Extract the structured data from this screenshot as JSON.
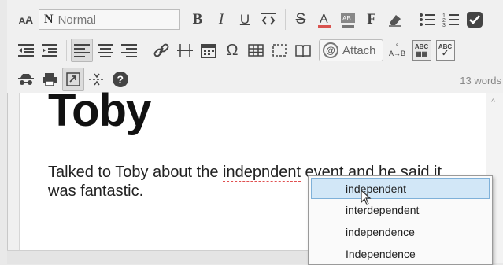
{
  "toolbar": {
    "style_select": {
      "letter": "N",
      "value": "Normal"
    },
    "attach_label": "Attach",
    "abc_labels": [
      "ABC",
      "ABC"
    ],
    "word_count": "13 words"
  },
  "document": {
    "title": "Toby",
    "paragraph": {
      "before": "Talked to Toby about the ",
      "misspelled": "indepndent",
      "after": " event and he said it was fantastic."
    }
  },
  "spell_menu": {
    "items": [
      "independent",
      "interdependent",
      "independence",
      "Independence"
    ]
  },
  "colors": {
    "highlight": "#d2e7f7",
    "misspell_underline": "#e05050"
  }
}
